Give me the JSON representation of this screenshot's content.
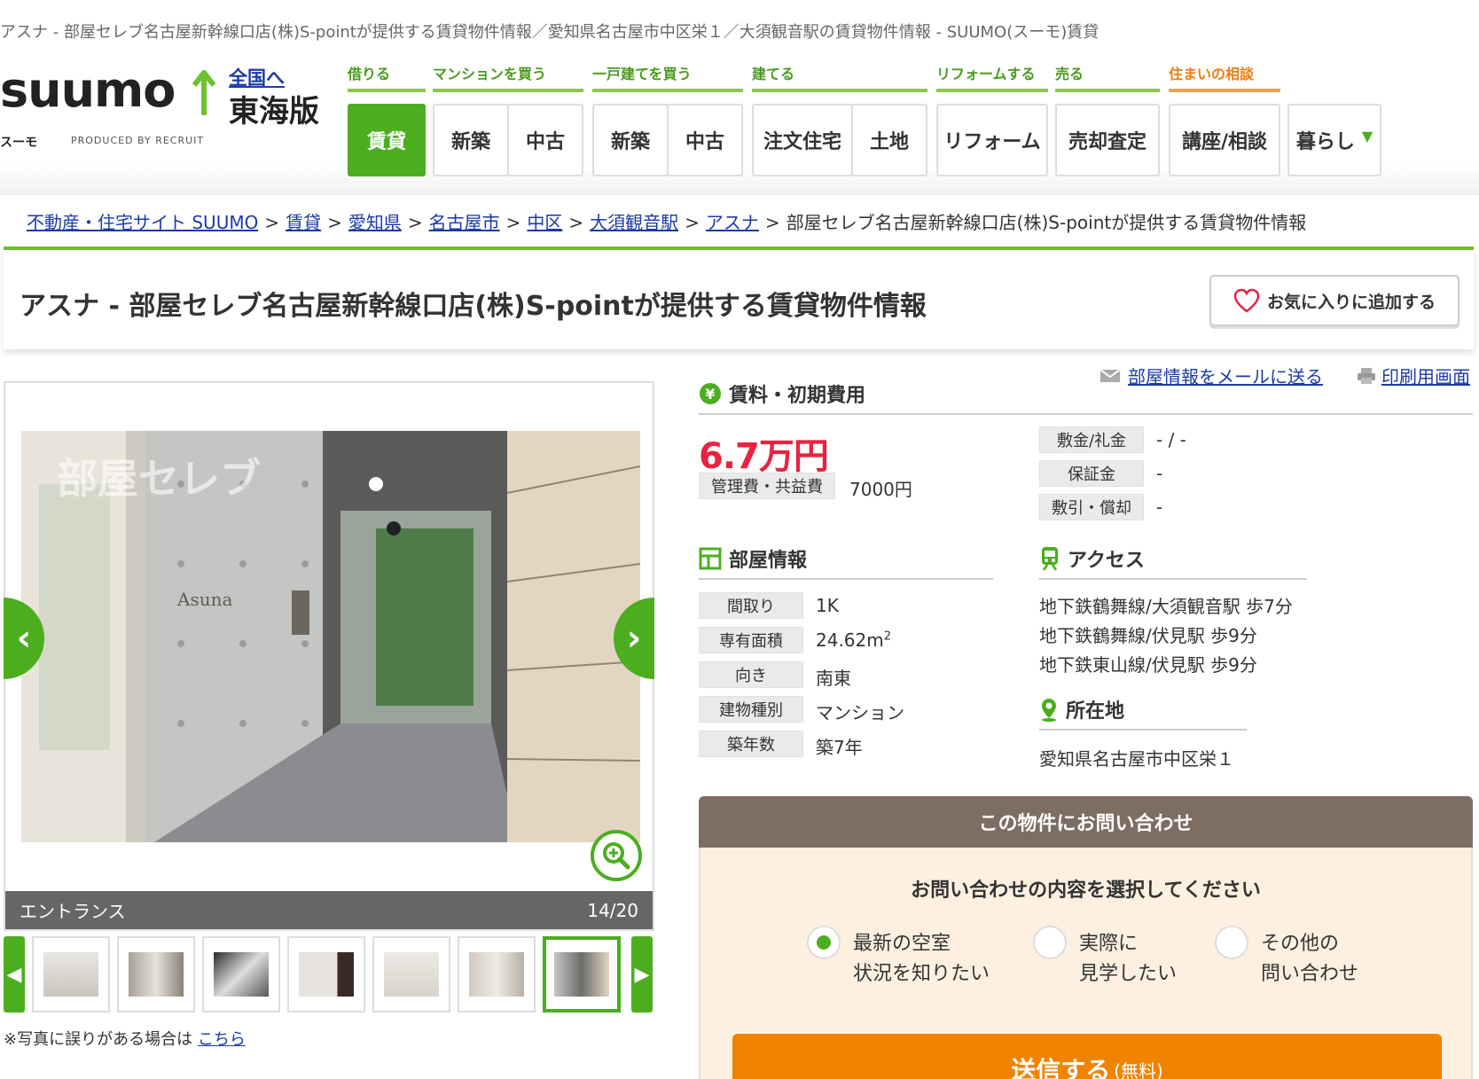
{
  "doc_title": "アスナ - 部屋セレブ名古屋新幹線口店(株)S-pointが提供する賃貸物件情報／愛知県名古屋市中区栄１／大須観音駅の賃貸物件情報 - SUUMO(スーモ)賃貸",
  "header": {
    "logo_word": "suumo",
    "logo_kana": "スーモ",
    "logo_byline": "PRODUCED BY RECRUIT",
    "national_link": "全国へ",
    "edition": "東海版",
    "categories": [
      "借りる",
      "マンションを買う",
      "一戸建てを買う",
      "建てる",
      "リフォームする",
      "売る",
      "住まいの相談"
    ],
    "tabs": [
      "賃貸",
      "新築",
      "中古",
      "新築",
      "中古",
      "注文住宅",
      "土地",
      "リフォーム",
      "売却査定",
      "講座/相談",
      "暮らし"
    ],
    "active_tab": "賃貸"
  },
  "breadcrumb": {
    "links": [
      "不動産・住宅サイト SUUMO",
      "賃貸",
      "愛知県",
      "名古屋市",
      "中区",
      "大須観音駅",
      "アスナ"
    ],
    "separator": ">",
    "current": "部屋セレブ名古屋新幹線口店(株)S-pointが提供する賃貸物件情報"
  },
  "title_box": {
    "title": "アスナ - 部屋セレブ名古屋新幹線口店(株)S-pointが提供する賃貸物件情報",
    "favorite_label": "お気に入りに追加する"
  },
  "gallery": {
    "caption": "エントランス",
    "counter": "14/20",
    "photo_sign": "Asuna",
    "photo_watermark": "部屋セレブ",
    "thumbnail_count": 7,
    "selected_thumbnail": 7,
    "note_text": "※写真に誤りがある場合は",
    "note_link": "こちら"
  },
  "tools": {
    "mail_link": "部屋情報をメールに送る",
    "print_link": "印刷用画面"
  },
  "costs": {
    "heading": "賃料・初期費用",
    "rent": "6.7万円",
    "mgmt_label": "管理費・共益費",
    "mgmt_value": "7000円",
    "rows": [
      {
        "label": "敷金/礼金",
        "value": "- / -"
      },
      {
        "label": "保証金",
        "value": "-"
      },
      {
        "label": "敷引・償却",
        "value": "-"
      }
    ]
  },
  "room": {
    "heading": "部屋情報",
    "rows": [
      {
        "label": "間取り",
        "value": "1K"
      },
      {
        "label": "専有面積",
        "value": "24.62m",
        "sup": "2"
      },
      {
        "label": "向き",
        "value": "南東"
      },
      {
        "label": "建物種別",
        "value": "マンション"
      },
      {
        "label": "築年数",
        "value": "築7年"
      }
    ]
  },
  "access": {
    "heading": "アクセス",
    "lines": [
      "地下鉄鶴舞線/大須観音駅 歩7分",
      "地下鉄鶴舞線/伏見駅 歩9分",
      "地下鉄東山線/伏見駅 歩9分"
    ]
  },
  "location": {
    "heading": "所在地",
    "address": "愛知県名古屋市中区栄１"
  },
  "inquiry": {
    "heading": "この物件にお問い合わせ",
    "prompt": "お問い合わせの内容を選択してください",
    "options": [
      "最新の空室\n状況を知りたい",
      "実際に\n見学したい",
      "その他の\n問い合わせ"
    ],
    "selected_option": 0,
    "submit_label": "送信する",
    "submit_note": "(無料)"
  },
  "colors": {
    "brand_green": "#4cae1f",
    "rent_red": "#e8233f",
    "submit_orange": "#f08300",
    "link_blue": "#1a3aa8",
    "inquiry_brown": "#7e6d62"
  }
}
